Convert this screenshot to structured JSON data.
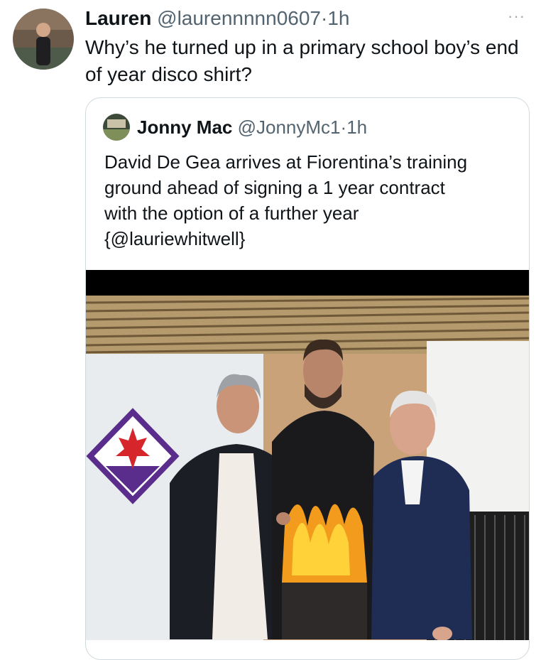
{
  "tweet": {
    "author_name": "Lauren",
    "author_handle": "@laurennnnn0607",
    "separator": "·",
    "time": "1h",
    "more_label": "···",
    "text": "Why’s he turned up in a primary school boy’s end of year disco shirt?"
  },
  "quoted": {
    "author_name": "Jonny Mac",
    "author_handle": "@JonnyMc1",
    "separator": "·",
    "time": "1h",
    "text_lines": [
      "David De Gea arrives at Fiorentina’s training",
      "ground ahead of signing a 1 year contract",
      "with the option of a further year",
      "{@lauriewhitwell}"
    ]
  },
  "colors": {
    "text": "#0f1419",
    "muted": "#536471",
    "border": "#cfd9de",
    "fiorentina_purple": "#5a2d8c",
    "fiorentina_red": "#d6262c"
  }
}
